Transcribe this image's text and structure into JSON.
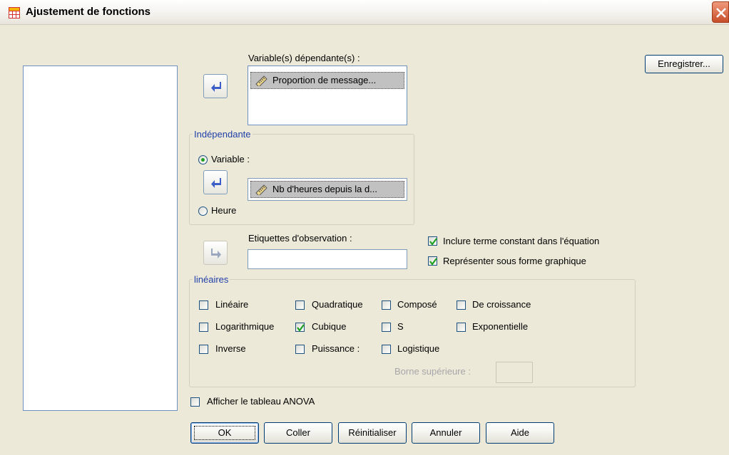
{
  "window": {
    "title": "Ajustement de fonctions"
  },
  "buttons": {
    "save": "Enregistrer...",
    "ok": "OK",
    "paste": "Coller",
    "reset": "Réinitialiser",
    "cancel": "Annuler",
    "help": "Aide"
  },
  "dependent": {
    "label": "Variable(s) dépendante(s) :",
    "items": [
      "Proportion de message..."
    ]
  },
  "independent": {
    "group_label": "Indépendante",
    "variable_label": "Variable :",
    "variable_selected": true,
    "variable_value": "Nb d'heures depuis la d...",
    "time_label": "Heure",
    "time_selected": false
  },
  "case_labels": {
    "label": "Etiquettes d'observation :",
    "value": ""
  },
  "options": {
    "include_constant": {
      "label": "Inclure terme constant dans l'équation",
      "checked": true
    },
    "plot_models": {
      "label": "Représenter sous forme graphique",
      "checked": true
    }
  },
  "models": {
    "group_label": "linéaires",
    "items": [
      {
        "label": "Linéaire",
        "checked": false
      },
      {
        "label": "Logarithmique",
        "checked": false
      },
      {
        "label": "Inverse",
        "checked": false
      },
      {
        "label": "Quadratique",
        "checked": false
      },
      {
        "label": "Cubique",
        "checked": true
      },
      {
        "label": "Puissance :",
        "checked": false
      },
      {
        "label": "Composé",
        "checked": false
      },
      {
        "label": "S",
        "checked": false
      },
      {
        "label": "Logistique",
        "checked": false
      },
      {
        "label": "De croissance",
        "checked": false
      },
      {
        "label": "Exponentielle",
        "checked": false
      }
    ],
    "upper_bound_label": "Borne supérieure :",
    "upper_bound_value": ""
  },
  "anova": {
    "label": "Afficher le tableau ANOVA",
    "checked": false
  },
  "colors": {
    "accent_blue": "#1f3ea8",
    "check_green": "#21a121",
    "arrow_blue": "#3b5ec7"
  }
}
